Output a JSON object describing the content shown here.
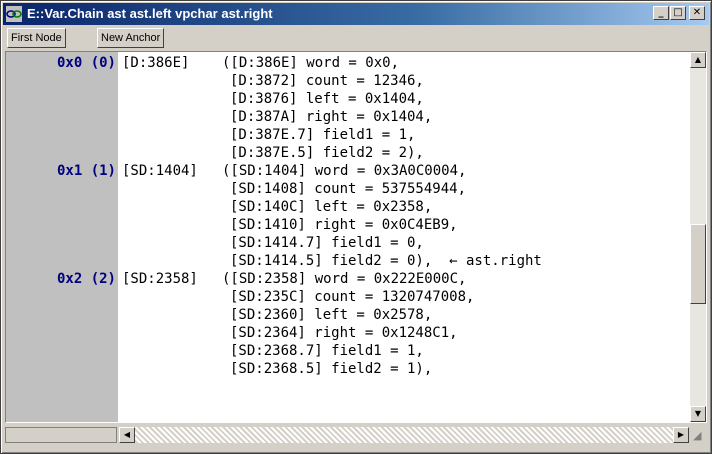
{
  "window": {
    "title": "E::Var.Chain ast ast.left vpchar ast.right",
    "controls": {
      "minimize": "_",
      "maximize": "□",
      "close": "✕"
    },
    "icon": "chain-app-icon"
  },
  "toolbar": {
    "first_node": "First Node",
    "new_anchor": "New Anchor"
  },
  "lines": [
    {
      "index": "0x0 (0)",
      "addr": "[D:386E]",
      "field": "([D:386E] word = 0x0,"
    },
    {
      "index": "",
      "addr": "",
      "field": "[D:3872] count = 12346,"
    },
    {
      "index": "",
      "addr": "",
      "field": "[D:3876] left = 0x1404,"
    },
    {
      "index": "",
      "addr": "",
      "field": "[D:387A] right = 0x1404,"
    },
    {
      "index": "",
      "addr": "",
      "field": "[D:387E.7] field1 = 1,"
    },
    {
      "index": "",
      "addr": "",
      "field": "[D:387E.5] field2 = 2),"
    },
    {
      "index": "0x1 (1)",
      "addr": "[SD:1404]",
      "field": "([SD:1404] word = 0x3A0C0004,"
    },
    {
      "index": "",
      "addr": "",
      "field": "[SD:1408] count = 537554944,"
    },
    {
      "index": "",
      "addr": "",
      "field": "[SD:140C] left = 0x2358,"
    },
    {
      "index": "",
      "addr": "",
      "field": "[SD:1410] right = 0x0C4EB9,"
    },
    {
      "index": "",
      "addr": "",
      "field": "[SD:1414.7] field1 = 0,"
    },
    {
      "index": "",
      "addr": "",
      "field": "[SD:1414.5] field2 = 0),  ← ast.right"
    },
    {
      "index": "0x2 (2)",
      "addr": "[SD:2358]",
      "field": "([SD:2358] word = 0x222E000C,"
    },
    {
      "index": "",
      "addr": "",
      "field": "[SD:235C] count = 1320747008,"
    },
    {
      "index": "",
      "addr": "",
      "field": "[SD:2360] left = 0x2578,"
    },
    {
      "index": "",
      "addr": "",
      "field": "[SD:2364] right = 0x1248C1,"
    },
    {
      "index": "",
      "addr": "",
      "field": "[SD:2368.7] field1 = 1,"
    },
    {
      "index": "",
      "addr": "",
      "field": "[SD:2368.5] field2 = 1),"
    }
  ],
  "scrollbars": {
    "up": "▲",
    "down": "▼",
    "left": "◀",
    "right": "▶",
    "grip": "◢"
  }
}
